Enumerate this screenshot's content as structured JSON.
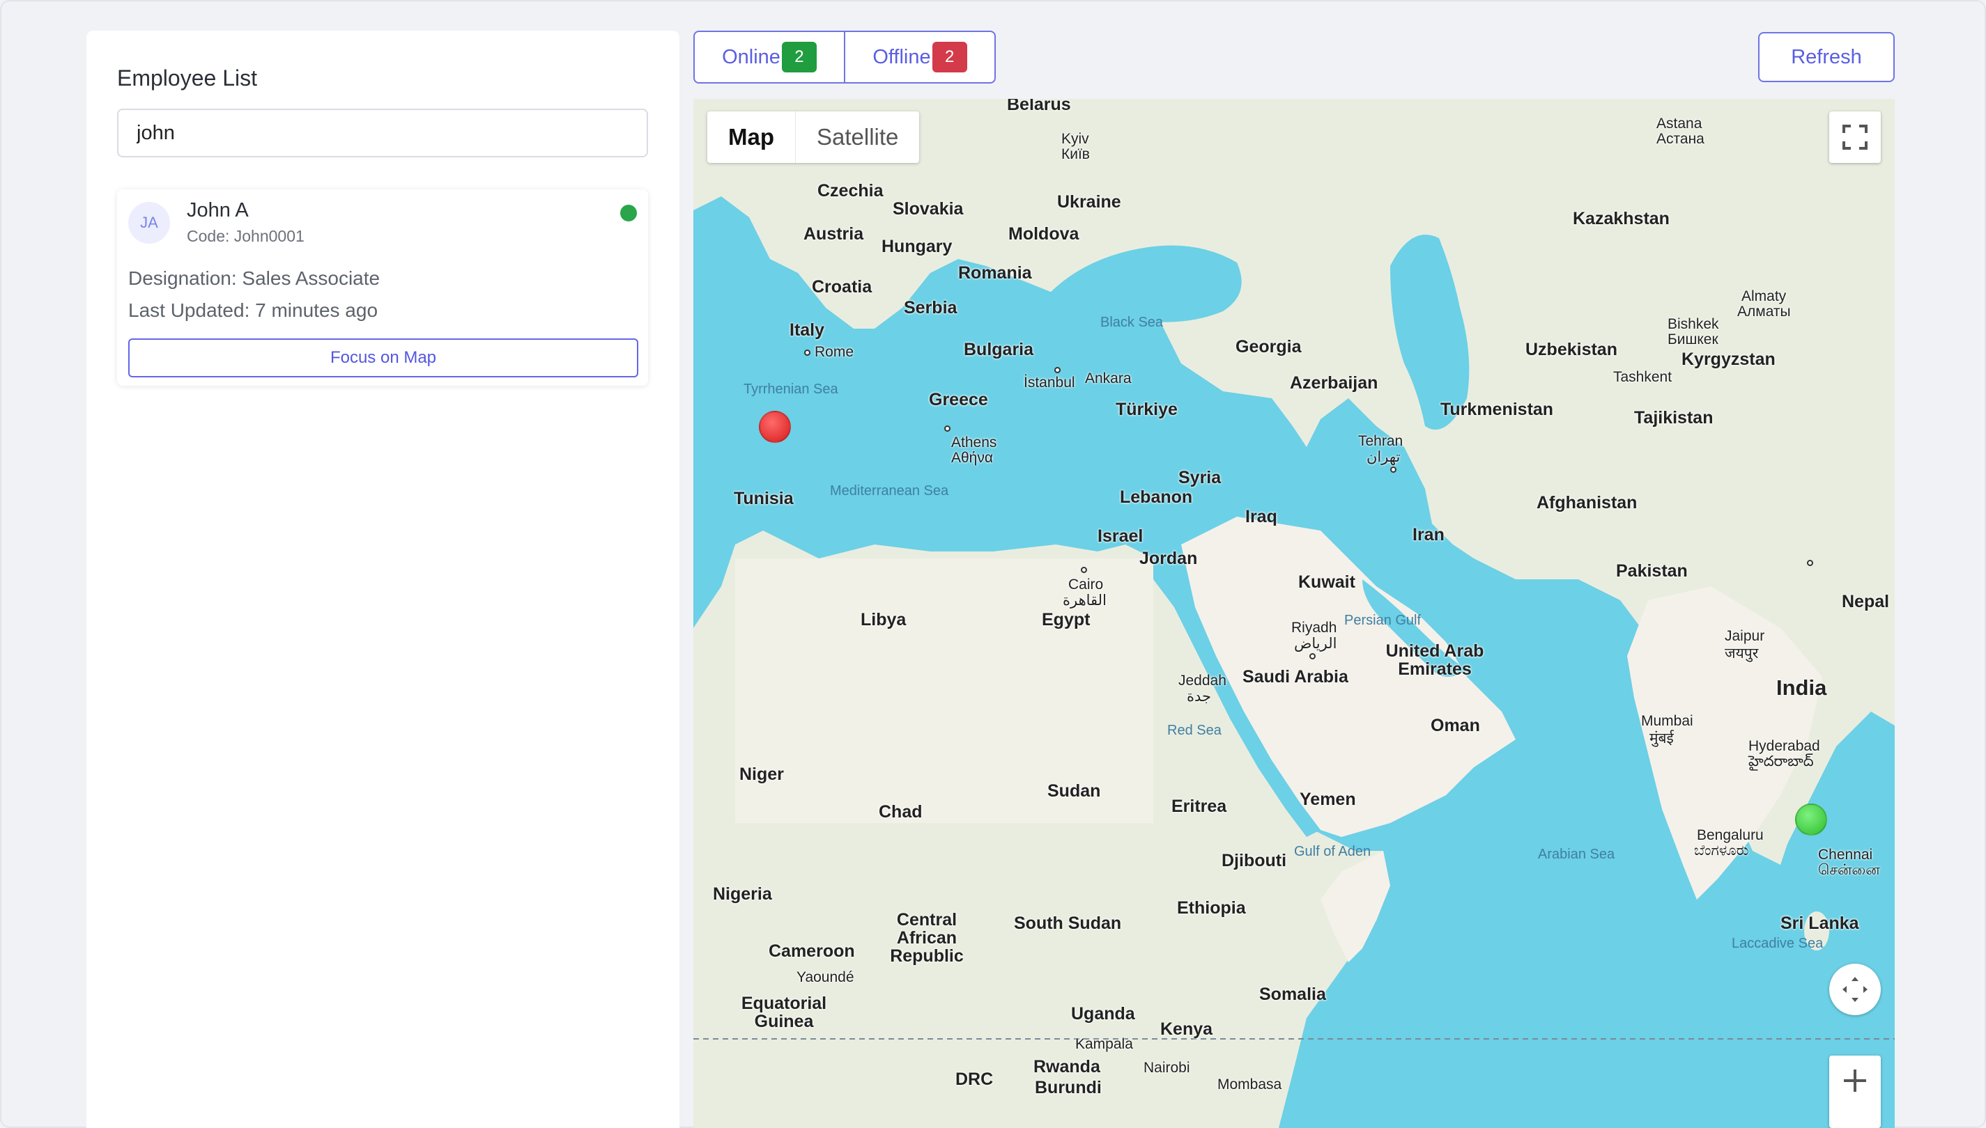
{
  "panel": {
    "title": "Employee List",
    "search_value": "john"
  },
  "employee": {
    "initials": "JA",
    "name": "John A",
    "code": "Code: John0001",
    "designation": "Designation: Sales Associate",
    "last_updated": "Last Updated: 7 minutes ago",
    "status_color": "#2aa54a",
    "focus_label": "Focus on Map"
  },
  "tabs": [
    {
      "label": "Online",
      "count": "2",
      "badge_color": "#1f9d3f"
    },
    {
      "label": "Offline",
      "count": "2",
      "badge_color": "#d33a4a"
    }
  ],
  "refresh_label": "Refresh",
  "map": {
    "type_map": "Map",
    "type_satellite": "Satellite",
    "markers": [
      {
        "status": "offline",
        "color": "#d81c1c",
        "near": "Tunis"
      },
      {
        "status": "online",
        "color": "#2ebe2e",
        "near": "Chennai"
      }
    ],
    "countries": [
      "Belarus",
      "Kazakhstan",
      "Czechia",
      "Slovakia",
      "Ukraine",
      "Austria",
      "Hungary",
      "Moldova",
      "Romania",
      "Croatia",
      "Serbia",
      "Italy",
      "Bulgaria",
      "Georgia",
      "Azerbaijan",
      "Uzbekistan",
      "Kyrgyzstan",
      "Greece",
      "Türkiye",
      "Turkmenistan",
      "Tajikistan",
      "Syria",
      "Lebanon",
      "Tunisia",
      "Iraq",
      "Afghanistan",
      "Iran",
      "Israel",
      "Jordan",
      "Kuwait",
      "Pakistan",
      "Nepal",
      "Libya",
      "Egypt",
      "Saudi Arabia",
      "United Arab Emirates",
      "India",
      "Oman",
      "Niger",
      "Chad",
      "Sudan",
      "Eritrea",
      "Yemen",
      "Djibouti",
      "Nigeria",
      "Ethiopia",
      "Central African Republic",
      "South Sudan",
      "Cameroon",
      "Equatorial Guinea",
      "Somalia",
      "Uganda",
      "Kenya",
      "Rwanda",
      "Burundi",
      "DRC",
      "Sri Lanka"
    ],
    "cities": [
      "Kyiv",
      "Київ",
      "Astana",
      "Астана",
      "Rome",
      "İstanbul",
      "Ankara",
      "Athens",
      "Αθήνα",
      "Tehran",
      "تهران",
      "Cairo",
      "القاهرة",
      "Riyadh",
      "الرياض",
      "Jeddah",
      "جدة",
      "Bishkek",
      "Бишкек",
      "Almaty",
      "Алматы",
      "Tashkent",
      "Jaipur",
      "जयपुर",
      "Mumbai",
      "मुंबई",
      "Hyderabad",
      "హైదరాబాద్",
      "Bengaluru",
      "ಬೆಂಗಳೂರು",
      "Chennai",
      "சென்னை",
      "Yaoundé",
      "Kampala",
      "Nairobi",
      "Mombasa"
    ],
    "seas": [
      "Black Sea",
      "Tyrrhenian Sea",
      "Mediterranean Sea",
      "Persian Gulf",
      "Red Sea",
      "Gulf of Aden",
      "Arabian Sea",
      "Laccadive Sea"
    ]
  }
}
